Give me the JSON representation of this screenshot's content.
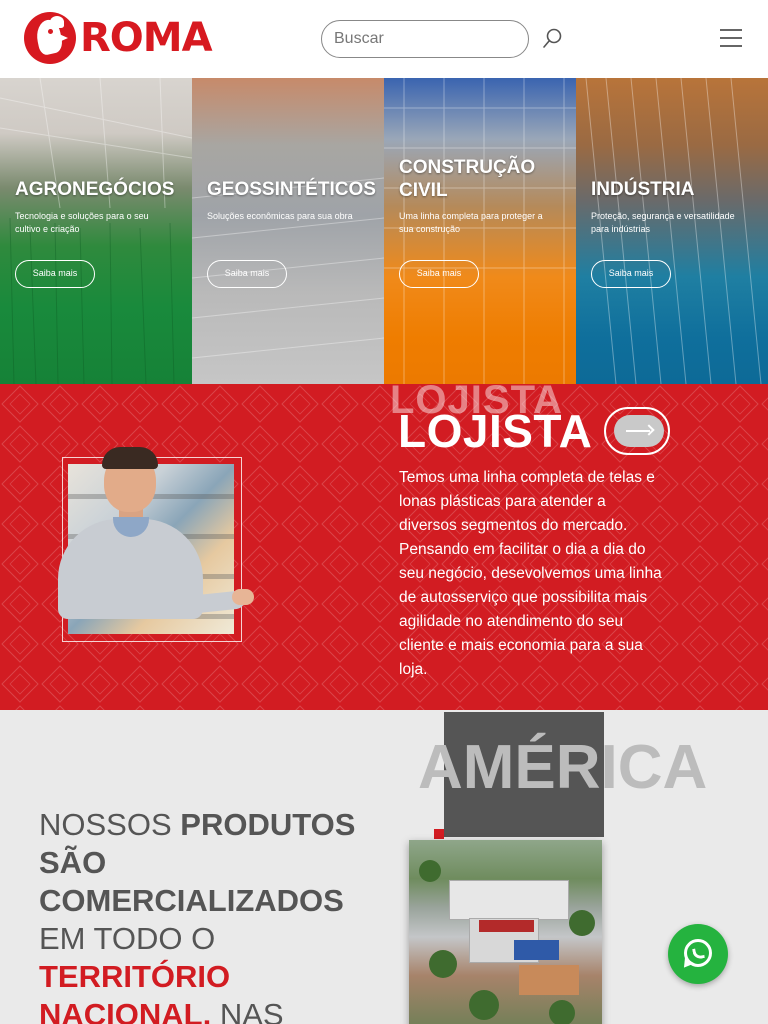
{
  "header": {
    "brand": "ROMA",
    "search_placeholder": "Buscar",
    "icons": [
      "search-icon",
      "hamburger-menu-icon"
    ]
  },
  "segments": [
    {
      "title": "AGRONEGÓCIOS",
      "description": "Tecnologia e soluções para o seu cultivo e criação",
      "button": "Saiba mais",
      "color": "#1a8a3c"
    },
    {
      "title": "GEOSSINTÉTICOS",
      "description": "Soluções econômicas para sua obra",
      "button": "Saiba mais",
      "color": "#bfbfbf"
    },
    {
      "title": "CONSTRUÇÃO CIVIL",
      "description": "Uma linha completa para proteger a sua construção",
      "button": "Saiba mais",
      "color": "#ef7d00"
    },
    {
      "title": "INDÚSTRIA",
      "description": "Proteção, segurança e versatilidade para indústrias",
      "button": "Saiba mais",
      "color": "#0e6c99"
    }
  ],
  "lojista": {
    "ghost_title": "LOJISTA",
    "title": "LOJISTA",
    "text": "Temos uma linha completa de telas e lonas plásticas para atender a diversos segmentos do mercado. Pensando em facilitar o dia a dia do seu negócio, desevolvemos uma linha de autosserviço que possibilita mais agilidade no atendimento do seu cliente e mais economia para a sua loja.",
    "background": "#d21c22"
  },
  "products": {
    "big_word": "AMÉRICA",
    "line1_light": "NOSSOS ",
    "line1_bold": "PRODUTOS",
    "line2_bold": "SÃO",
    "line3_bold": "COMERCIALIZADOS",
    "line4_light": "EM TODO O",
    "line5_red": "TERRITÓRIO",
    "line6_red": "NACIONAL,",
    "line6_light": " NAS"
  },
  "colors": {
    "brand_red": "#d71920",
    "whatsapp_green": "#25b33f"
  }
}
